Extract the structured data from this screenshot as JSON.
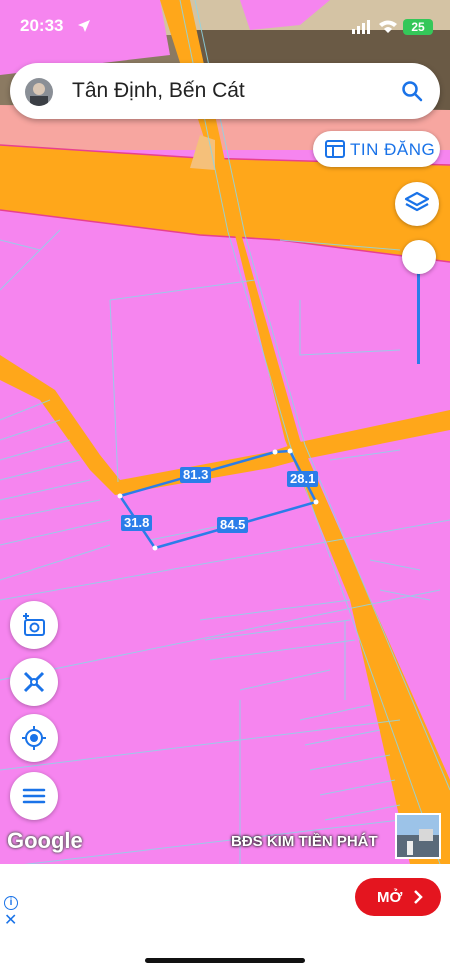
{
  "status": {
    "time": "20:33",
    "battery": "25"
  },
  "search": {
    "query": "Tân Định, Bến Cát",
    "search_icon": "search-icon",
    "avatar_icon": "avatar"
  },
  "post_button": {
    "label": "TIN ĐĂNG",
    "icon": "listing-icon"
  },
  "layers_icon": "layers-icon",
  "parcel_dimensions": {
    "top": "81.3",
    "right": "28.1",
    "left": "31.8",
    "bottom": "84.5"
  },
  "fab_buttons": [
    {
      "name": "add-photo-location",
      "icon": "add-photo-icon"
    },
    {
      "name": "measure-tool",
      "icon": "ruler-icon"
    },
    {
      "name": "my-location",
      "icon": "crosshair-icon"
    },
    {
      "name": "menu",
      "icon": "menu-icon"
    }
  ],
  "watermark": {
    "google": "Google",
    "brand": "BĐS KIM TIỀN PHÁT"
  },
  "ad": {
    "cta": "MỞ"
  },
  "colors": {
    "zone_residential": "#f685ef",
    "road": "#ffa71a",
    "commercial": "#f7a6a0",
    "accent": "#1a73e8",
    "cta": "#e4151f"
  }
}
